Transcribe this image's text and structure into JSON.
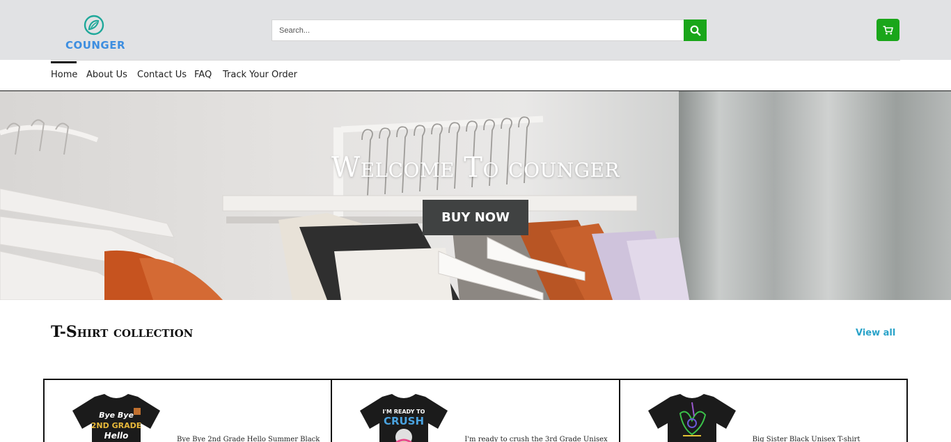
{
  "brand": {
    "name": "COUNGER",
    "logo_icon": "leaf-circle-icon",
    "color": "#3d8ee0"
  },
  "search": {
    "placeholder": "Search...",
    "icon": "search-icon"
  },
  "cart": {
    "icon": "cart-icon"
  },
  "accent_color": "#1aa61a",
  "nav": {
    "items": [
      {
        "label": "Home",
        "active": true
      },
      {
        "label": "About Us"
      },
      {
        "label": "Contact Us"
      },
      {
        "label": "FAQ"
      },
      {
        "label": "Track Your Order"
      }
    ]
  },
  "hero": {
    "title": "Welcome To counger",
    "button_label": "BUY NOW"
  },
  "collection": {
    "title": "T-Shirt collection",
    "view_all": "View all",
    "products": [
      {
        "title": "Bye Bye 2nd Grade Hello Summer Black",
        "print_lines": [
          "Bye Bye",
          "2ND GRADE",
          "Hello"
        ]
      },
      {
        "title": "I'm ready to crush the 3rd Grade Unisex",
        "print_lines": [
          "I'M READY TO",
          "CRUSH"
        ]
      },
      {
        "title": "Big Sister Black Unisex T-shirt",
        "print_lines": []
      }
    ]
  }
}
